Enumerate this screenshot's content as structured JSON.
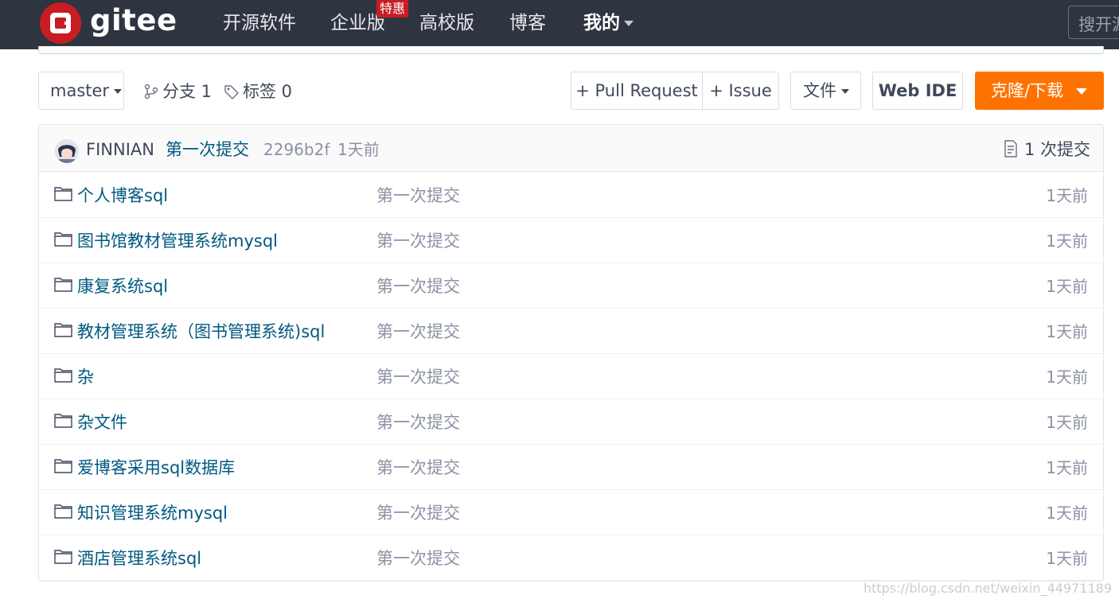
{
  "colors": {
    "navbar_bg": "#2e3440",
    "brand_red": "#c71d23",
    "accent_orange": "#fe7300",
    "link_blue": "#005980",
    "muted_gray": "#8c92a4"
  },
  "navbar": {
    "logo_text": "gitee",
    "items": [
      {
        "label": "开源软件"
      },
      {
        "label": "企业版"
      },
      {
        "label": "高校版"
      },
      {
        "label": "博客"
      },
      {
        "label": "我的"
      }
    ],
    "promo_badge": "特惠",
    "search_placeholder": "搜开源"
  },
  "toolbar": {
    "branch": "master",
    "branches_label": "分支 1",
    "tags_label": "标签 0",
    "pull_request_label": "+ Pull Request",
    "issue_label": "+ Issue",
    "file_label": "文件",
    "web_ide_label": "Web IDE",
    "clone_label": "克隆/下载"
  },
  "commit": {
    "author": "FINNIAN",
    "message": "第一次提交",
    "sha": "2296b2f",
    "time": "1天前",
    "count_label": "1 次提交"
  },
  "files": [
    {
      "name": "个人博客sql",
      "message": "第一次提交",
      "time": "1天前"
    },
    {
      "name": "图书馆教材管理系统mysql",
      "message": "第一次提交",
      "time": "1天前"
    },
    {
      "name": "康复系统sql",
      "message": "第一次提交",
      "time": "1天前"
    },
    {
      "name": "教材管理系统（图书管理系统)sql",
      "message": "第一次提交",
      "time": "1天前"
    },
    {
      "name": "杂",
      "message": "第一次提交",
      "time": "1天前"
    },
    {
      "name": "杂文件",
      "message": "第一次提交",
      "time": "1天前"
    },
    {
      "name": "爱博客采用sql数据库",
      "message": "第一次提交",
      "time": "1天前"
    },
    {
      "name": "知识管理系统mysql",
      "message": "第一次提交",
      "time": "1天前"
    },
    {
      "name": "酒店管理系统sql",
      "message": "第一次提交",
      "time": "1天前"
    }
  ],
  "watermark": "https://blog.csdn.net/weixin_44971189"
}
